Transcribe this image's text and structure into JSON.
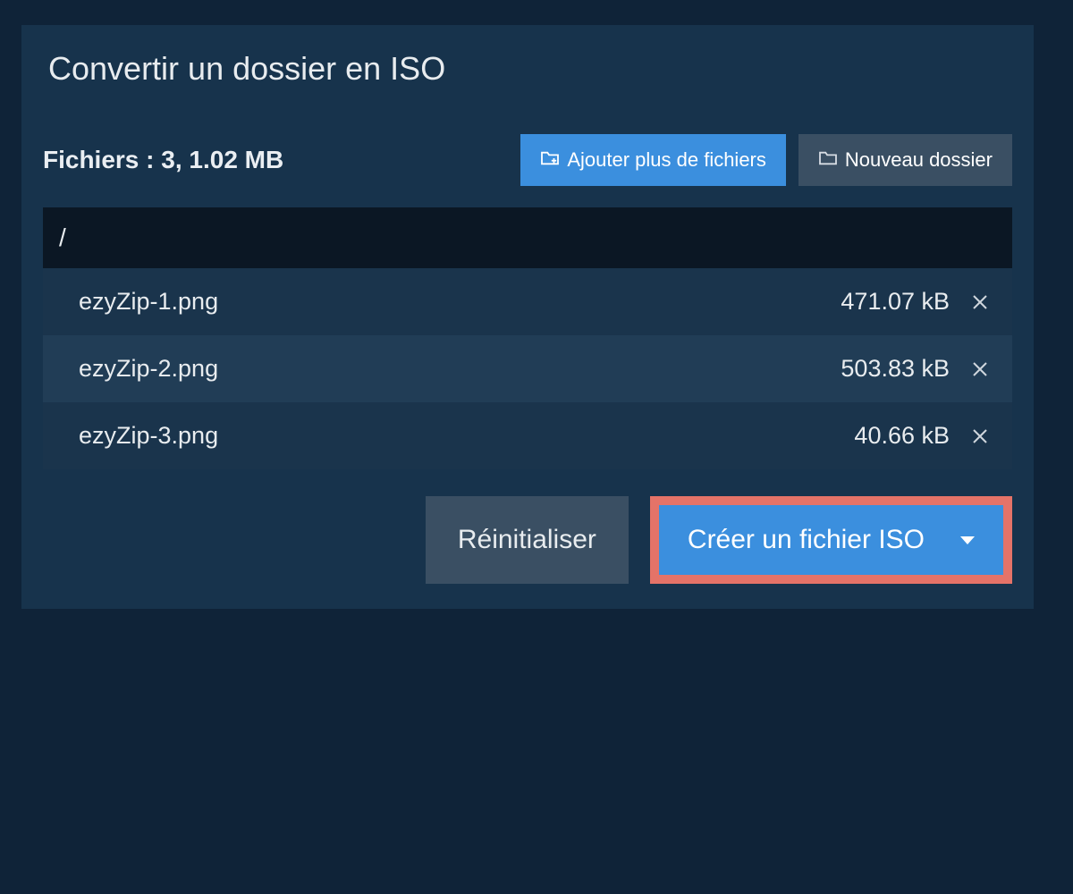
{
  "tab": {
    "title": "Convertir un dossier en ISO"
  },
  "summary": {
    "label": "Fichiers :",
    "count": "3,",
    "size": "1.02 MB"
  },
  "toolbar": {
    "add_files_label": "Ajouter plus de fichiers",
    "new_folder_label": "Nouveau dossier"
  },
  "path": "/",
  "files": [
    {
      "name": "ezyZip-1.png",
      "size": "471.07 kB"
    },
    {
      "name": "ezyZip-2.png",
      "size": "503.83 kB"
    },
    {
      "name": "ezyZip-3.png",
      "size": "40.66 kB"
    }
  ],
  "footer": {
    "reset_label": "Réinitialiser",
    "create_label": "Créer un fichier ISO"
  }
}
